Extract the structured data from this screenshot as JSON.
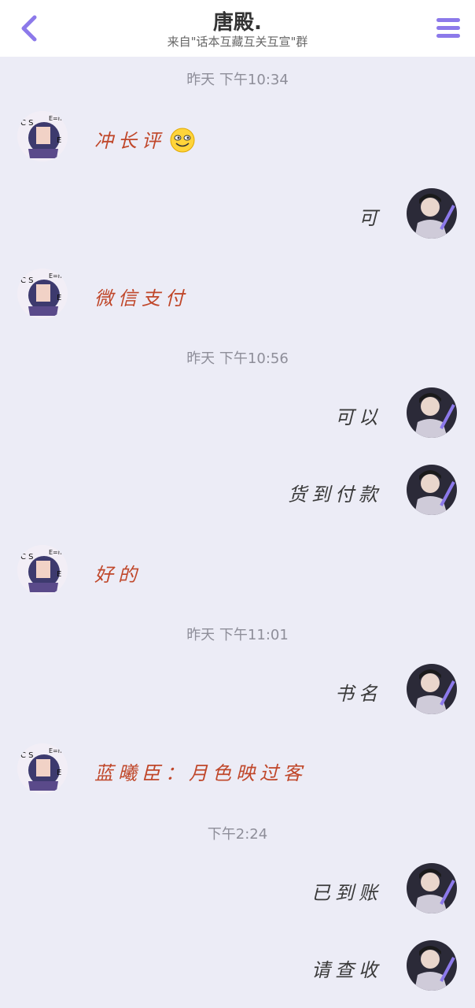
{
  "header": {
    "title": "唐殿.",
    "subtitle": "来自\"话本互藏互关互宣\"群"
  },
  "messages": {
    "t1": "昨天 下午10:34",
    "m1": "冲长评",
    "m2": "可",
    "m3": "微信支付",
    "t2": "昨天 下午10:56",
    "m4": "可以",
    "m5": "货到付款",
    "m6": "好的",
    "t3": "昨天 下午11:01",
    "m7": "书名",
    "m8": "蓝曦臣：月色映过客",
    "t4": "下午2:24",
    "m9": "已到账",
    "m10": "请查收"
  },
  "colors": {
    "accent": "#8c79ea",
    "left_text": "#c0472a",
    "right_text": "#3a3a3a"
  }
}
